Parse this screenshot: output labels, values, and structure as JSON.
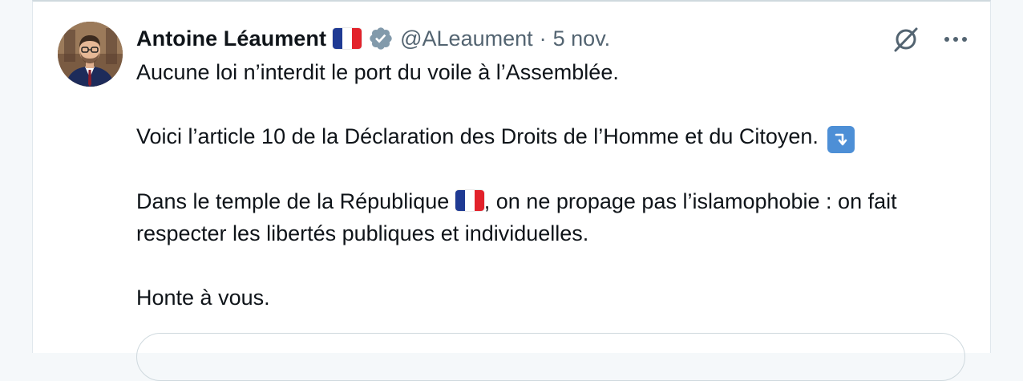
{
  "tweet": {
    "author": {
      "name": "Antoine Léaument",
      "handle": "@ALeaument",
      "avatar_icon": "profile-photo",
      "flag_icon": "france-flag",
      "verified_icon": "verified-badge"
    },
    "separator": "·",
    "date": "5 nov.",
    "header_icons": [
      "grok-icon",
      "more-icon"
    ],
    "body": {
      "line1": "Aucune loi n’interdit le port du voile à l’Assemblée.",
      "line2": "Voici l’article 10 de la Déclaration des Droits de l’Homme et du Citoyen.",
      "line2_emoji": "arrow-down-right-icon",
      "line3_before_flag": "Dans le temple de la République",
      "line3_after_flag": ", on ne propage pas l’islamophobie : on fait respecter les libertés publiques et individuelles.",
      "line4": "Honte à vous."
    }
  },
  "colors": {
    "text": "#0f1419",
    "secondary": "#536471",
    "verified": "#829aab",
    "emoji_blue": "#4d8fd6",
    "flag_blue": "#1f3a93",
    "flag_red": "#e2222b"
  }
}
